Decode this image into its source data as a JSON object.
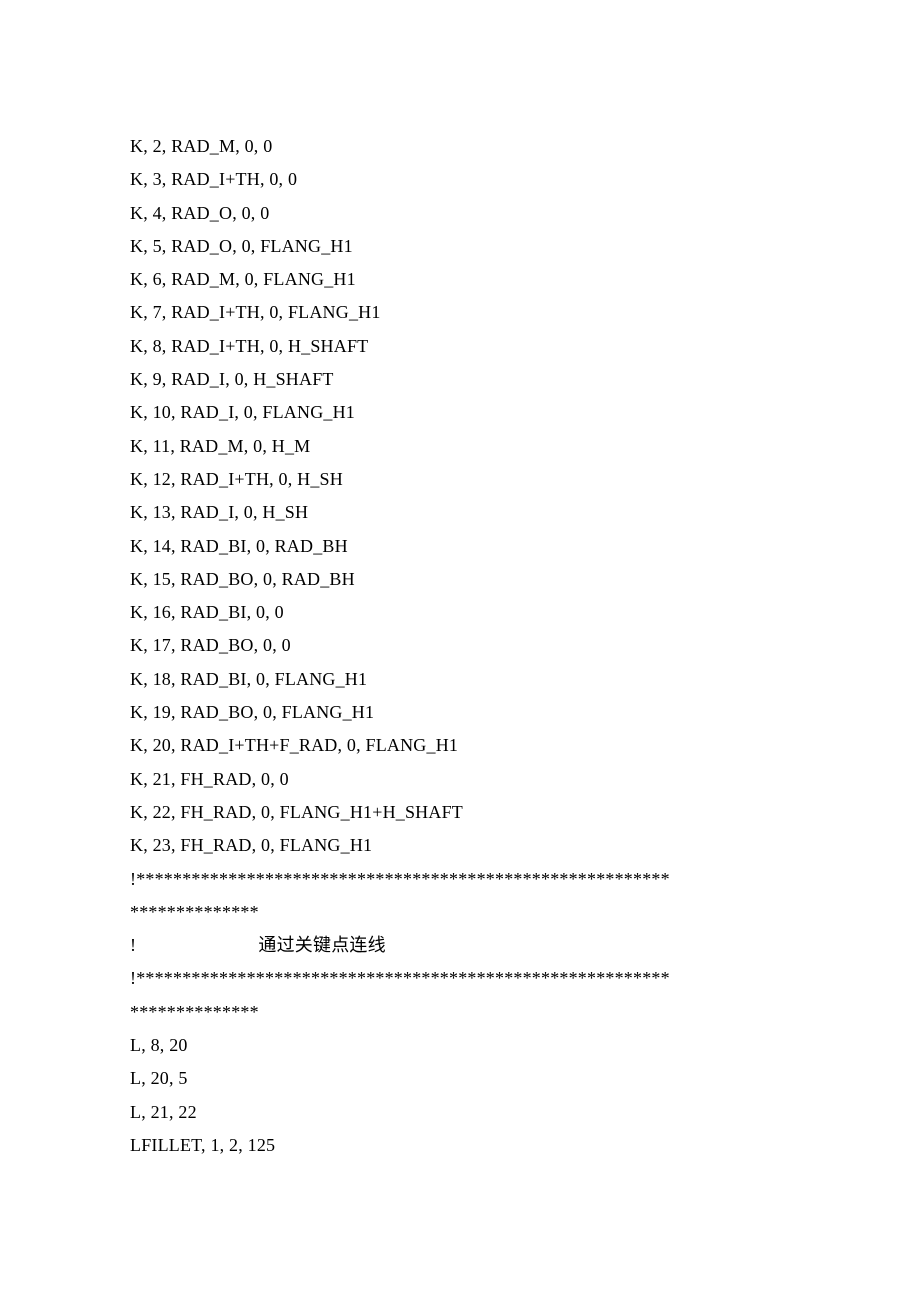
{
  "lines": [
    "K, 2, RAD_M, 0, 0",
    "K, 3, RAD_I+TH, 0, 0",
    "K, 4, RAD_O, 0, 0",
    "K, 5, RAD_O, 0, FLANG_H1",
    "K, 6, RAD_M, 0, FLANG_H1",
    "K, 7, RAD_I+TH, 0, FLANG_H1",
    "K, 8, RAD_I+TH, 0, H_SHAFT",
    "K, 9, RAD_I, 0, H_SHAFT",
    "K, 10, RAD_I, 0, FLANG_H1",
    "K, 11, RAD_M, 0, H_M",
    "K, 12, RAD_I+TH, 0, H_SH",
    "K, 13, RAD_I, 0, H_SH",
    "K, 14, RAD_BI, 0, RAD_BH",
    "K, 15, RAD_BO, 0, RAD_BH",
    "K, 16, RAD_BI, 0, 0",
    "K, 17, RAD_BO, 0, 0",
    "K, 18, RAD_BI, 0, FLANG_H1",
    "K, 19, RAD_BO, 0, FLANG_H1",
    "K, 20, RAD_I+TH+F_RAD, 0, FLANG_H1",
    "K, 21, FH_RAD, 0, 0",
    "K, 22, FH_RAD, 0, FLANG_H1+H_SHAFT",
    "K, 23, FH_RAD, 0, FLANG_H1",
    "!**********************************************************",
    "**************",
    "!                          通过关键点连线",
    "!**********************************************************",
    "**************",
    "L, 8, 20",
    "L, 20, 5",
    "L, 21, 22",
    "LFILLET, 1, 2, 125"
  ]
}
